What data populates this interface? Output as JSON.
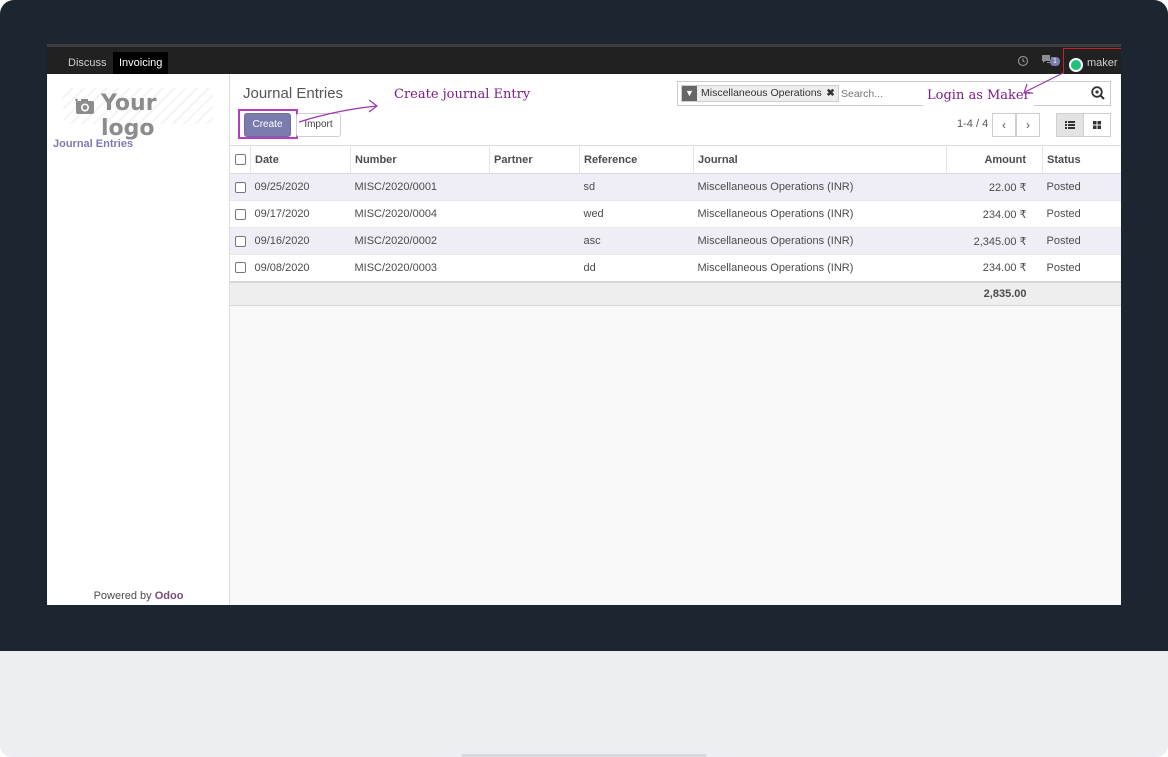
{
  "topbar": {
    "menu": [
      "Discuss",
      "Invoicing"
    ],
    "active_menu": "Invoicing",
    "clock_icon": "clock-icon",
    "chat_icon": "chat-icon",
    "chat_count": "1",
    "username": "maker"
  },
  "sidebar": {
    "logo_text": "Your logo",
    "link": "Journal Entries",
    "powered_by": "Powered by",
    "brand": "Odoo"
  },
  "control_panel": {
    "title": "Journal Entries",
    "create_label": "Create",
    "import_label": "Import",
    "facet": "Miscellaneous Operations",
    "search_placeholder": "Search...",
    "pager": "1-4 / 4"
  },
  "annotations": {
    "create": "Create journal Entry",
    "login": "Login as Maker"
  },
  "table": {
    "columns": [
      "Date",
      "Number",
      "Partner",
      "Reference",
      "Journal",
      "Amount",
      "Status"
    ],
    "rows": [
      {
        "date": "09/25/2020",
        "number": "MISC/2020/0001",
        "partner": "",
        "reference": "sd",
        "journal": "Miscellaneous Operations (INR)",
        "amount": "22.00 ₹",
        "status": "Posted"
      },
      {
        "date": "09/17/2020",
        "number": "MISC/2020/0004",
        "partner": "",
        "reference": "wed",
        "journal": "Miscellaneous Operations (INR)",
        "amount": "234.00 ₹",
        "status": "Posted"
      },
      {
        "date": "09/16/2020",
        "number": "MISC/2020/0002",
        "partner": "",
        "reference": "asc",
        "journal": "Miscellaneous Operations (INR)",
        "amount": "2,345.00 ₹",
        "status": "Posted"
      },
      {
        "date": "09/08/2020",
        "number": "MISC/2020/0003",
        "partner": "",
        "reference": "dd",
        "journal": "Miscellaneous Operations (INR)",
        "amount": "234.00 ₹",
        "status": "Posted"
      }
    ],
    "total": "2,835.00"
  },
  "colors": {
    "accent": "#7c7bad",
    "annotation": "#7b1c89",
    "highlight_red": "#c0252b"
  }
}
